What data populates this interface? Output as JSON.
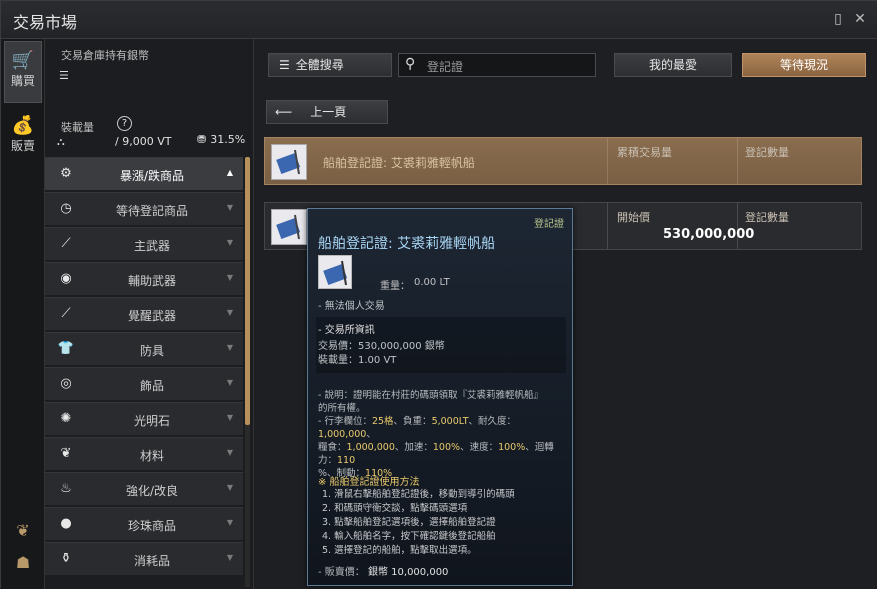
{
  "window": {
    "title": "交易市場"
  },
  "rail": {
    "buy_label": "購買",
    "sell_label": "販賣"
  },
  "wallet": {
    "silver_label": "交易倉庫持有銀幣",
    "load_label": "裝載量",
    "load_value": "/ 9,000 VT",
    "load_pct": "31.5%"
  },
  "categories": [
    {
      "label": "暴漲/跌商品",
      "icon": "trend-icon",
      "active": true
    },
    {
      "label": "等待登記商品",
      "icon": "clock-icon"
    },
    {
      "label": "主武器",
      "icon": "sword-icon"
    },
    {
      "label": "輔助武器",
      "icon": "shield-icon"
    },
    {
      "label": "覺醒武器",
      "icon": "awakening-weapon-icon"
    },
    {
      "label": "防具",
      "icon": "armor-icon"
    },
    {
      "label": "飾品",
      "icon": "ring-icon"
    },
    {
      "label": "光明石",
      "icon": "crystal-icon"
    },
    {
      "label": "材料",
      "icon": "material-icon"
    },
    {
      "label": "強化/改良",
      "icon": "enhance-icon"
    },
    {
      "label": "珍珠商品",
      "icon": "pearl-icon"
    },
    {
      "label": "消耗品",
      "icon": "potion-icon"
    }
  ],
  "toolbar": {
    "all_search": "全體搜尋",
    "search_placeholder": "登記證",
    "favorites": "我的最愛",
    "waiting": "等待現況",
    "back": "上一頁"
  },
  "results": [
    {
      "name": "船舶登記證: 艾裘莉雅輕帆船",
      "col1_head": "累積交易量",
      "col2_head": "登記數量",
      "col1_value": "",
      "col2_value": ""
    },
    {
      "name": "",
      "col1_head": "開始價",
      "col2_head": "登記數量",
      "col1_value": "530,000,000",
      "col2_value": ""
    }
  ],
  "tooltip": {
    "type": "登記證",
    "title": "船舶登記證: 艾裘莉雅輕帆船",
    "weight_label": "重量：",
    "weight_value": "0.00 LT",
    "no_trade": "- 無法個人交易",
    "trade_info": "- 交易所資訊",
    "trade_price": "交易價：530,000,000 銀幣",
    "load": "裝載量：1.00 VT",
    "desc1": "- 說明：證明能在村莊的碼頭領取『艾裘莉雅輕帆船』",
    "desc2": "的所有權。",
    "desc3a": "- 行李欄位：",
    "desc3b": "25格",
    "desc3c": "、負重：",
    "desc3d": "5,000LT",
    "desc3e": "、耐久度：",
    "desc3f": "1,000,000",
    "desc3g": "、",
    "desc4a": "糧食：",
    "desc4b": "1,000,000",
    "desc4c": "、加速：",
    "desc4d": "100%",
    "desc4e": "、速度：",
    "desc4f": "100%",
    "desc4g": "、迴轉力：",
    "desc4h": "110",
    "desc5a": "%、制動：",
    "desc5b": "110%",
    "howto_title": "※ 船舶登記證使用方法",
    "steps": [
      "1. 滑鼠右擊船舶登記證後，移動到導引的碼頭",
      "2. 和碼頭守衛交談，點擊碼頭選項",
      "3. 點擊船舶登記選項後，選擇船舶登記證",
      "4. 輸入船舶名字，按下確認鍵後登記船舶",
      "5. 選擇登記的船舶，點擊取出選項。"
    ],
    "sell_price_label": "- 販賣價：",
    "sell_price_value": "銀幣 10,000,000"
  },
  "colors": {
    "accent": "#b0845a",
    "highlight_row": "#8a6d4f",
    "tooltip_title": "#a9d7f5"
  }
}
